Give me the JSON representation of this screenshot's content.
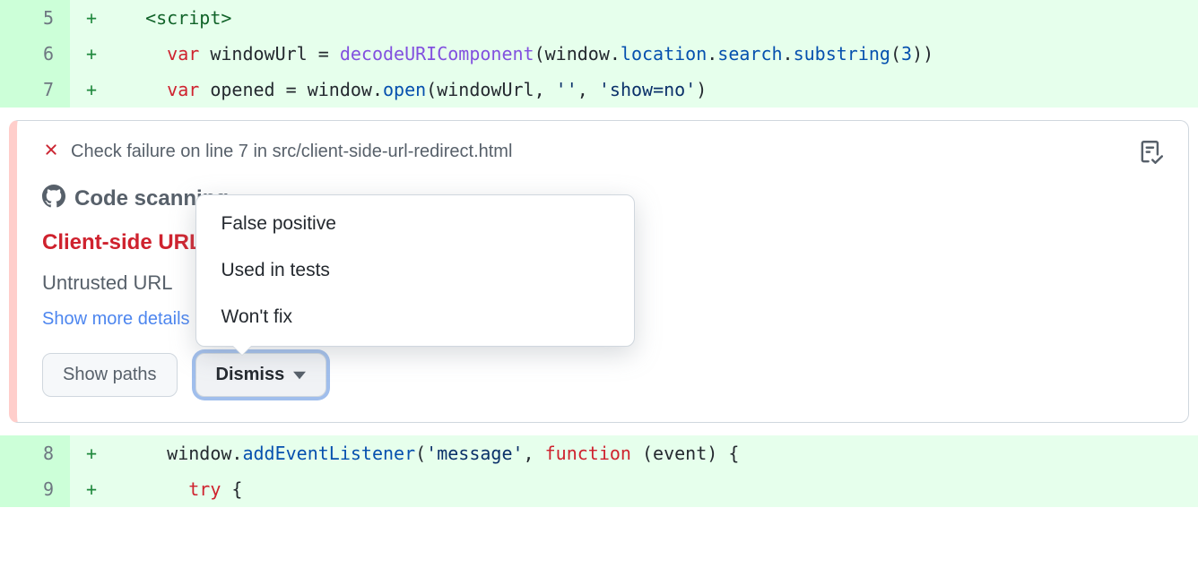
{
  "code": {
    "lines": [
      {
        "num": "5",
        "marker": "+",
        "html": "  <span class='tok-tag'>&lt;script&gt;</span>"
      },
      {
        "num": "6",
        "marker": "+",
        "html": "    <span class='tok-kw'>var</span> windowUrl = <span class='tok-fn'>decodeURIComponent</span>(window.<span class='tok-fn2'>location</span>.<span class='tok-fn2'>search</span>.<span class='tok-fn2'>substring</span>(<span class='tok-num'>3</span>))"
      },
      {
        "num": "7",
        "marker": "+",
        "html": "    <span class='tok-kw'>var</span> opened = window.<span class='tok-fn2'>open</span>(windowUrl, <span class='tok-str'>''</span>, <span class='tok-str'>'show=no'</span>)"
      }
    ],
    "lines_after": [
      {
        "num": "8",
        "marker": "+",
        "html": "    window.<span class='tok-fn2'>addEventListener</span>(<span class='tok-str'>'message'</span>, <span class='tok-kw'>function</span> (event) {"
      },
      {
        "num": "9",
        "marker": "+",
        "html": "      <span class='tok-kw'>try</span> {"
      }
    ]
  },
  "annotation": {
    "location_text": "Check failure on line 7 in src/client-side-url-redirect.html",
    "scanner_title": "Code scanning",
    "rule_name": "Client-side URL",
    "description": "Untrusted URL ",
    "details_link": "Show more details",
    "buttons": {
      "show_paths": "Show paths",
      "dismiss": "Dismiss"
    },
    "dismiss_menu": [
      "False positive",
      "Used in tests",
      "Won't fix"
    ]
  }
}
